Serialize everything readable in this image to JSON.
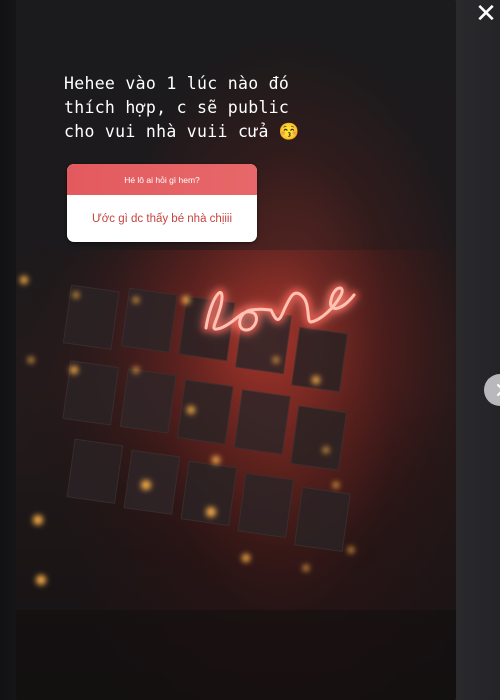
{
  "story": {
    "caption": "Hehee vào 1 lúc nào đó\nthích hợp, c sẽ public\ncho vui nhà vuii cửa 😚",
    "question_sticker": {
      "prompt": "Hé lô ai hỏi gì hem?",
      "answer": "Ước gì dc thấy bé nhà chịiii"
    },
    "photo": {
      "description_icon": "neon-love-sign-icon",
      "neon_color": "#ffb6a8",
      "glow_color": "#ff3b2f"
    }
  },
  "controls": {
    "close_icon": "close-icon",
    "close_label": "✕",
    "next_icon": "chevron-right-icon"
  },
  "colors": {
    "sticker_header": "#e35a5e",
    "sticker_answer_text": "#c7433f",
    "background": "#0e0e10"
  }
}
